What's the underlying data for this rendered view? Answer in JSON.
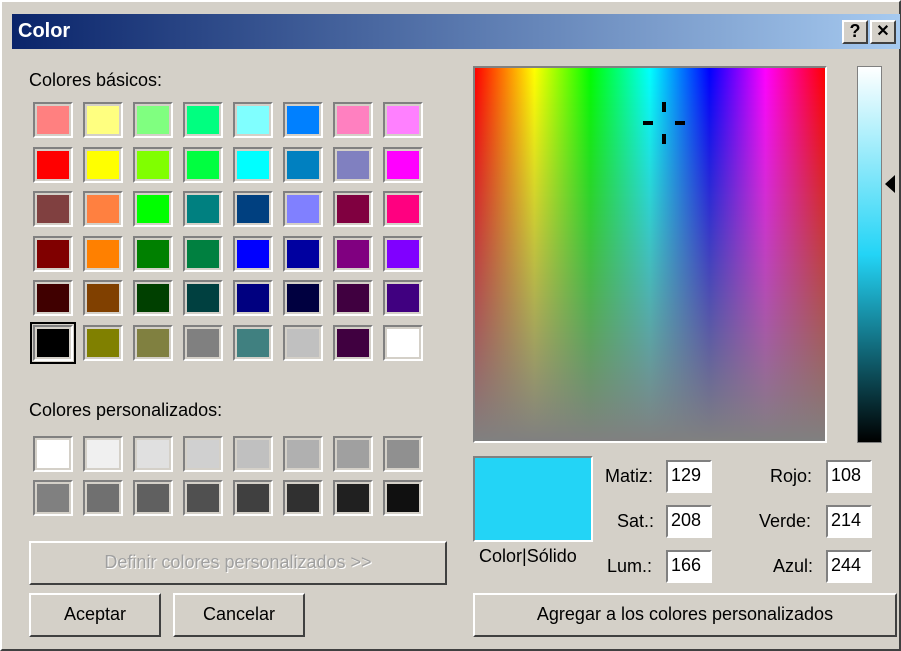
{
  "window": {
    "title": "Color",
    "help_label": "?",
    "close_label": "✕"
  },
  "basic": {
    "label": "Colores básicos:",
    "colors": [
      "#ff8080",
      "#ffff80",
      "#80ff80",
      "#00ff80",
      "#80ffff",
      "#0080ff",
      "#ff80c0",
      "#ff80ff",
      "#ff0000",
      "#ffff00",
      "#80ff00",
      "#00ff40",
      "#00ffff",
      "#0080c0",
      "#8080c0",
      "#ff00ff",
      "#804040",
      "#ff8040",
      "#00ff00",
      "#008080",
      "#004080",
      "#8080ff",
      "#800040",
      "#ff0080",
      "#800000",
      "#ff8000",
      "#008000",
      "#008040",
      "#0000ff",
      "#0000a0",
      "#800080",
      "#8000ff",
      "#400000",
      "#804000",
      "#004000",
      "#004040",
      "#000080",
      "#000040",
      "#400040",
      "#400080",
      "#000000",
      "#808000",
      "#808040",
      "#808080",
      "#408080",
      "#c0c0c0",
      "#400040",
      "#ffffff"
    ]
  },
  "custom": {
    "label": "Colores personalizados:",
    "colors": [
      "#ffffff",
      "#f0f0f0",
      "#e0e0e0",
      "#d0d0d0",
      "#c0c0c0",
      "#b0b0b0",
      "#a0a0a0",
      "#909090",
      "#808080",
      "#707070",
      "#606060",
      "#505050",
      "#404040",
      "#303030",
      "#202020",
      "#101010"
    ]
  },
  "buttons": {
    "define": "Definir colores personalizados >>",
    "ok": "Aceptar",
    "cancel": "Cancelar",
    "add": "Agregar a los colores personalizados"
  },
  "solid": {
    "label": "Color|Sólido",
    "color": "#23d4f6"
  },
  "fields": {
    "hue": {
      "label": "Matiz:",
      "value": "129"
    },
    "sat": {
      "label": "Sat.:",
      "value": "208"
    },
    "lum": {
      "label": "Lum.:",
      "value": "166"
    },
    "red": {
      "label": "Rojo:",
      "value": "108"
    },
    "green": {
      "label": "Verde:",
      "value": "214"
    },
    "blue": {
      "label": "Azul:",
      "value": "244"
    }
  }
}
